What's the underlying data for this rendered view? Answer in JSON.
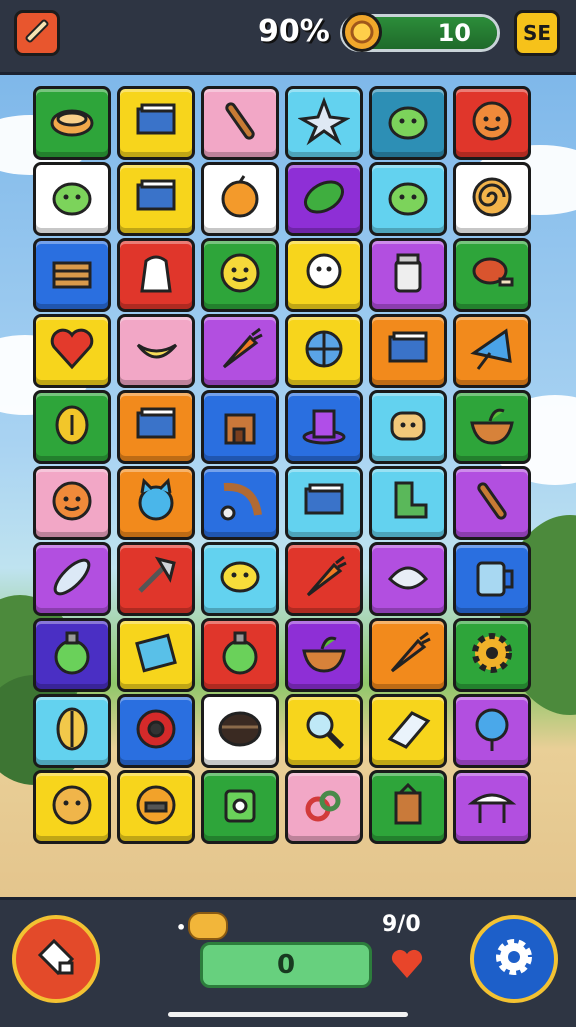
{
  "hud": {
    "percent": "90%",
    "progress_value": "10",
    "progress_fraction": 1.0,
    "se_label": "SE",
    "bottom_score": "0",
    "bottom_counter": "9/0"
  },
  "colors": {
    "green": "#2ea53a",
    "yellow": "#f7d51c",
    "pink": "#f2a7c6",
    "cyan": "#63d2ef",
    "teal": "#2d8fb5",
    "red": "#e0362b",
    "white": "#ffffff",
    "purple": "#8e2fd6",
    "blue": "#2a6fe0",
    "orange": "#f28a1c",
    "violet": "#b24fe0",
    "indigo": "#4a2fc4"
  },
  "board": {
    "rows": [
      [
        {
          "c": "green",
          "icon": "pie-icon"
        },
        {
          "c": "yellow",
          "icon": "book-icon"
        },
        {
          "c": "pink",
          "icon": "bat-icon"
        },
        {
          "c": "cyan",
          "icon": "star-icon"
        },
        {
          "c": "teal",
          "icon": "slime-icon"
        },
        {
          "c": "red",
          "icon": "monster-icon"
        }
      ],
      [
        {
          "c": "white",
          "icon": "slime-icon"
        },
        {
          "c": "yellow",
          "icon": "book-icon"
        },
        {
          "c": "white",
          "icon": "orange-icon"
        },
        {
          "c": "purple",
          "icon": "leaf-icon"
        },
        {
          "c": "cyan",
          "icon": "slime-icon"
        },
        {
          "c": "white",
          "icon": "roll-icon"
        }
      ],
      [
        {
          "c": "blue",
          "icon": "crate-icon"
        },
        {
          "c": "red",
          "icon": "cloth-icon"
        },
        {
          "c": "green",
          "icon": "smile-icon"
        },
        {
          "c": "yellow",
          "icon": "ghost-icon"
        },
        {
          "c": "violet",
          "icon": "jar-icon"
        },
        {
          "c": "green",
          "icon": "meat-icon"
        }
      ],
      [
        {
          "c": "yellow",
          "icon": "heart-icon"
        },
        {
          "c": "pink",
          "icon": "banana-icon"
        },
        {
          "c": "violet",
          "icon": "carrot-icon"
        },
        {
          "c": "yellow",
          "icon": "globe-icon"
        },
        {
          "c": "orange",
          "icon": "book-icon"
        },
        {
          "c": "orange",
          "icon": "umbrella-icon"
        }
      ],
      [
        {
          "c": "green",
          "icon": "coin-icon"
        },
        {
          "c": "orange",
          "icon": "book-icon"
        },
        {
          "c": "blue",
          "icon": "castle-icon"
        },
        {
          "c": "blue",
          "icon": "hat-icon"
        },
        {
          "c": "cyan",
          "icon": "bread-icon"
        },
        {
          "c": "green",
          "icon": "bowl-icon"
        }
      ],
      [
        {
          "c": "pink",
          "icon": "monster-icon"
        },
        {
          "c": "orange",
          "icon": "cat-icon"
        },
        {
          "c": "blue",
          "icon": "hook-icon"
        },
        {
          "c": "cyan",
          "icon": "book-icon"
        },
        {
          "c": "cyan",
          "icon": "boot-icon"
        },
        {
          "c": "violet",
          "icon": "bat-icon"
        }
      ],
      [
        {
          "c": "violet",
          "icon": "feather-icon"
        },
        {
          "c": "red",
          "icon": "axe-icon"
        },
        {
          "c": "cyan",
          "icon": "cheese-icon"
        },
        {
          "c": "red",
          "icon": "carrot-icon"
        },
        {
          "c": "violet",
          "icon": "fish-icon"
        },
        {
          "c": "blue",
          "icon": "mug-icon"
        }
      ],
      [
        {
          "c": "indigo",
          "icon": "potion-icon"
        },
        {
          "c": "yellow",
          "icon": "card-icon"
        },
        {
          "c": "red",
          "icon": "potion-icon"
        },
        {
          "c": "purple",
          "icon": "bowl-icon"
        },
        {
          "c": "orange",
          "icon": "carrot-icon"
        },
        {
          "c": "green",
          "icon": "gear-icon"
        }
      ],
      [
        {
          "c": "cyan",
          "icon": "seed-icon"
        },
        {
          "c": "blue",
          "icon": "ball-icon"
        },
        {
          "c": "white",
          "icon": "pot-icon"
        },
        {
          "c": "yellow",
          "icon": "magnifier-icon"
        },
        {
          "c": "yellow",
          "icon": "paper-icon"
        },
        {
          "c": "violet",
          "icon": "mirror-icon"
        }
      ],
      [
        {
          "c": "yellow",
          "icon": "cookie-icon"
        },
        {
          "c": "yellow",
          "icon": "helmet-icon"
        },
        {
          "c": "green",
          "icon": "box-icon"
        },
        {
          "c": "pink",
          "icon": "rings-icon"
        },
        {
          "c": "green",
          "icon": "bag-icon"
        },
        {
          "c": "violet",
          "icon": "table-icon"
        }
      ]
    ]
  }
}
